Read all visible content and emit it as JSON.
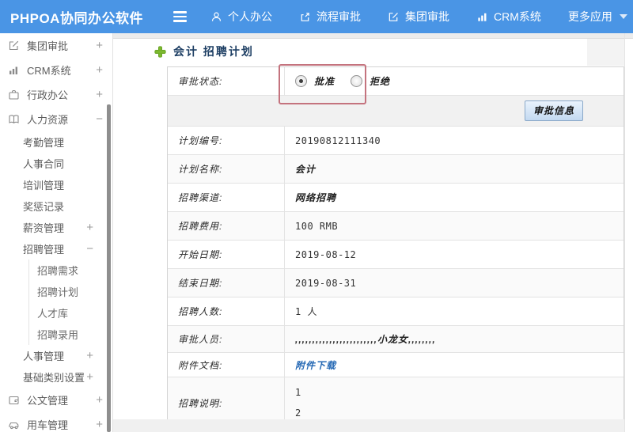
{
  "topbar": {
    "brand": "PHPOA协同办公软件",
    "menu": [
      {
        "label": "个人办公",
        "icon": "person-icon"
      },
      {
        "label": "流程审批",
        "icon": "process-approval-icon"
      },
      {
        "label": "集团审批",
        "icon": "compose-icon"
      },
      {
        "label": "CRM系统",
        "icon": "bar-chart-icon"
      },
      {
        "label": "更多应用",
        "icon": "caret-down-icon"
      }
    ]
  },
  "sidebar": {
    "items": [
      {
        "label": "集团审批",
        "expander": "+",
        "icon": "compose-icon"
      },
      {
        "label": "CRM系统",
        "expander": "+",
        "icon": "bar-chart-icon"
      },
      {
        "label": "行政办公",
        "expander": "+",
        "icon": "briefcase-icon"
      },
      {
        "label": "人力资源",
        "expander": "−",
        "icon": "book-icon"
      },
      {
        "label": "考勤管理",
        "expander": ""
      },
      {
        "label": "人事合同",
        "expander": ""
      },
      {
        "label": "培训管理",
        "expander": ""
      },
      {
        "label": "奖惩记录",
        "expander": ""
      },
      {
        "label": "薪资管理",
        "expander": "+"
      },
      {
        "label": "招聘管理",
        "expander": "−"
      },
      {
        "label": "招聘需求",
        "expander": ""
      },
      {
        "label": "招聘计划",
        "expander": ""
      },
      {
        "label": "人才库",
        "expander": ""
      },
      {
        "label": "招聘录用",
        "expander": ""
      },
      {
        "label": "人事管理",
        "expander": "+"
      },
      {
        "label": "基础类别设置",
        "expander": "+"
      },
      {
        "label": "公文管理",
        "expander": "+",
        "icon": "document-icon"
      },
      {
        "label": "用车管理",
        "expander": "+",
        "icon": "car-icon"
      }
    ]
  },
  "content": {
    "page_title": "会计 招聘计划",
    "approval_status": {
      "label": "审批状态:",
      "approve": "批准",
      "reject": "拒绝",
      "selected": "批准"
    },
    "approve_info_button": "审批信息",
    "rows": [
      {
        "label": "计划编号:",
        "value": "20190812111340"
      },
      {
        "label": "计划名称:",
        "value": "会计"
      },
      {
        "label": "招聘渠道:",
        "value": "网络招聘"
      },
      {
        "label": "招聘费用:",
        "value": "100 RMB"
      },
      {
        "label": "开始日期:",
        "value": "2019-08-12"
      },
      {
        "label": "结束日期:",
        "value": "2019-08-31"
      },
      {
        "label": "招聘人数:",
        "value": "1 人"
      },
      {
        "label": "审批人员:",
        "value": ",,,,,,,,,,,,,,,,,,,,,,,,小龙女,,,,,,,,"
      },
      {
        "label": "附件文档:",
        "value": "附件下载"
      },
      {
        "label": "招聘说明:",
        "lines": [
          "1",
          "2"
        ]
      }
    ],
    "colors": {
      "topbar_blue": "#4a95e5",
      "annotation_red": "#c4737e",
      "link_blue": "#2468b4",
      "title_navy": "#1d3e63",
      "plus_green": "#7cb82f"
    }
  }
}
